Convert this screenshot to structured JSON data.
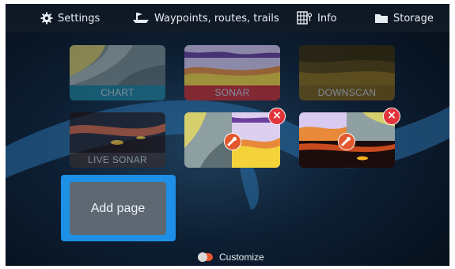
{
  "menu": {
    "settings": "Settings",
    "waypoints": "Waypoints, routes, trails",
    "info": "Info",
    "storage": "Storage"
  },
  "tiles": {
    "chart": "CHART",
    "sonar": "SONAR",
    "downscan": "DOWNSCAN",
    "live_sonar": "LIVE SONAR"
  },
  "add_page": "Add page",
  "customize": "Customize",
  "colors": {
    "accent": "#1e8fe6",
    "close": "#e2333b",
    "wrench": "#e4572e",
    "chart_label_bg": "#1d7e96",
    "sonar_label_bg": "#c6282a",
    "downscan_label_bg": "#7a5a12",
    "live_sonar_label_bg": "#3a2f2f"
  },
  "icons": [
    "gear-icon",
    "boat-waypoint-icon",
    "info-grid-icon",
    "folder-icon",
    "close-icon",
    "wrench-icon",
    "toggle-icon"
  ]
}
